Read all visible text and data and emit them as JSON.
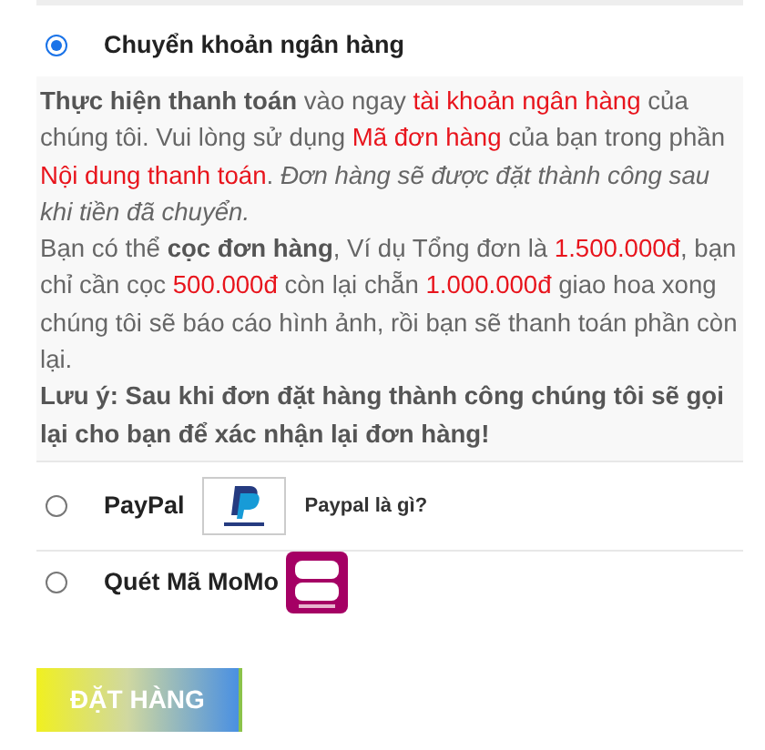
{
  "methods": [
    {
      "kind": "bank",
      "label": "Chuyển khoản ngân hàng",
      "selected": true
    },
    {
      "kind": "paypal",
      "label": "PayPal",
      "link": "Paypal là gì?",
      "selected": false
    },
    {
      "kind": "momo",
      "label": "Quét Mã MoMo",
      "selected": false
    }
  ],
  "description": [
    [
      {
        "kind": "bold",
        "text": "Thực hiện thanh toán"
      },
      {
        "kind": "plain",
        "text": " vào ngay "
      },
      {
        "kind": "red",
        "text": "tài khoản ngân hàng"
      },
      {
        "kind": "plain",
        "text": " của chúng tôi. Vui lòng sử dụng "
      },
      {
        "kind": "red",
        "text": "Mã đơn hàng"
      },
      {
        "kind": "plain",
        "text": " của bạn trong phần "
      },
      {
        "kind": "red",
        "text": "Nội dung thanh toán"
      },
      {
        "kind": "plain",
        "text": ". "
      },
      {
        "kind": "italic",
        "text": "Đơn hàng sẽ được đặt thành công sau khi tiền đã chuyển."
      }
    ],
    [
      {
        "kind": "plain",
        "text": "Bạn có thể "
      },
      {
        "kind": "bold",
        "text": "cọc đơn hàng"
      },
      {
        "kind": "plain",
        "text": ", Ví dụ Tổng đơn là "
      },
      {
        "kind": "red",
        "text": "1.500.000đ"
      },
      {
        "kind": "plain",
        "text": ", bạn chỉ cần cọc "
      },
      {
        "kind": "red",
        "text": "500.000đ"
      },
      {
        "kind": "plain",
        "text": " còn lại chẵn "
      },
      {
        "kind": "red",
        "text": "1.000.000đ"
      },
      {
        "kind": "plain",
        "text": " giao hoa xong chúng tôi sẽ báo cáo hình ảnh, rồi bạn sẽ thanh toán phần còn lại."
      }
    ],
    [
      {
        "kind": "bold",
        "text": "Lưu ý: Sau khi đơn đặt hàng thành công chúng tôi sẽ gọi lại cho bạn để xác nhận lại đơn hàng!"
      }
    ]
  ],
  "submit": "ĐẶT HÀNG"
}
